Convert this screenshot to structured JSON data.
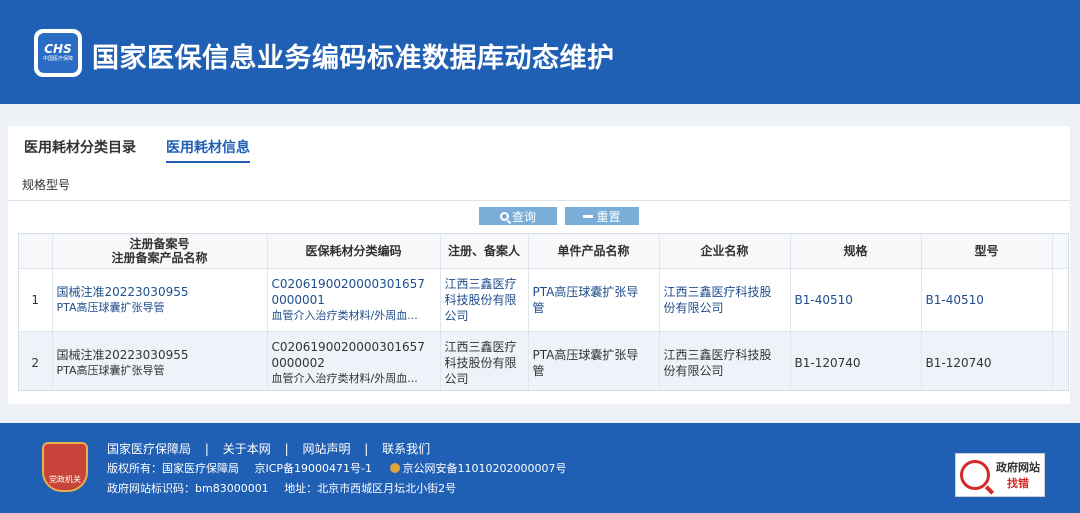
{
  "header": {
    "logo_text": "CHS",
    "logo_sub": "中国医疗保障",
    "title": "国家医保信息业务编码标准数据库动态维护"
  },
  "tabs": [
    {
      "label": "医用耗材分类目录"
    },
    {
      "label": "医用耗材信息"
    }
  ],
  "filters": {
    "spec_model_label": "规格型号"
  },
  "buttons": {
    "query": "查询",
    "reset": "重置"
  },
  "table": {
    "headers": {
      "reg_no": "注册备案号",
      "reg_product": "注册备案产品名称",
      "class_code": "医保耗材分类编码",
      "registrant": "注册、备案人",
      "product_name": "单件产品名称",
      "company": "企业名称",
      "spec": "规格",
      "model": "型号"
    },
    "rows": [
      {
        "index": "1",
        "reg_no": "国械注准20223030955",
        "reg_product": "PTA高压球囊扩张导管",
        "code_line1": "C0206190020000301657",
        "code_line2": "0000001",
        "class_desc": "血管介入治疗类材料/外周血...",
        "reg_line1": "江西三鑫医疗",
        "reg_line2": "科技股份有限",
        "reg_line3": "公司",
        "prod_line1": "PTA高压球囊扩张导",
        "prod_line2": "管",
        "comp_line1": "江西三鑫医疗科技股",
        "comp_line2": "份有限公司",
        "spec": "B1-40510",
        "model": "B1-40510"
      },
      {
        "index": "2",
        "reg_no": "国械注准20223030955",
        "reg_product": "PTA高压球囊扩张导管",
        "code_line1": "C0206190020000301657",
        "code_line2": "0000002",
        "class_desc": "血管介入治疗类材料/外周血...",
        "reg_line1": "江西三鑫医疗",
        "reg_line2": "科技股份有限",
        "reg_line3": "公司",
        "prod_line1": "PTA高压球囊扩张导",
        "prod_line2": "管",
        "comp_line1": "江西三鑫医疗科技股",
        "comp_line2": "份有限公司",
        "spec": "B1-120740",
        "model": "B1-120740"
      }
    ]
  },
  "footer": {
    "emblem_text": "党政机关",
    "links": [
      "国家医疗保障局",
      "关于本网",
      "网站声明",
      "联系我们"
    ],
    "separator": "|",
    "copyright": "版权所有：国家医疗保障局",
    "icp": "京ICP备19000471号-1",
    "police": "京公网安备11010202000007号",
    "site_id": "政府网站标识码：bm83000001",
    "address": "地址：北京市西城区月坛北小街2号",
    "error_badge_top": "政府网站",
    "error_badge_bottom": "找错"
  },
  "colors": {
    "brand_blue": "#1f5fb4",
    "button_blue": "#7aaed8",
    "link_blue": "#1f4e8c",
    "row_alt": "#eef3fa"
  }
}
